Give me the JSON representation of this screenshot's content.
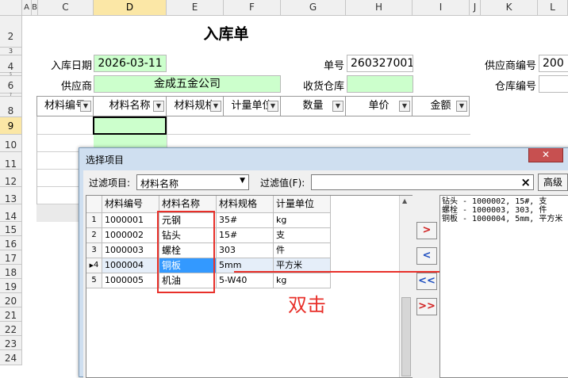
{
  "sheet": {
    "columns": [
      {
        "label": "A"
      },
      {
        "label": "B"
      },
      {
        "label": "C"
      },
      {
        "label": "D"
      },
      {
        "label": "E"
      },
      {
        "label": "F"
      },
      {
        "label": "G"
      },
      {
        "label": "H"
      },
      {
        "label": "I"
      },
      {
        "label": "J"
      },
      {
        "label": "K"
      },
      {
        "label": "L"
      }
    ],
    "rows": [
      "2",
      "3",
      "4",
      "5",
      "6",
      "7",
      "8",
      "9",
      "10",
      "11",
      "12",
      "13",
      "14",
      "15",
      "16",
      "17",
      "18",
      "19",
      "20",
      "21",
      "22",
      "23",
      "24"
    ],
    "title": "入库单",
    "form": {
      "date_label": "入库日期",
      "date_value": "2026-03-11",
      "order_label": "单号",
      "order_value": "260327001",
      "supplier_code_label": "供应商编号",
      "supplier_code_value": "200",
      "supplier_label": "供应商",
      "supplier_value": "金成五金公司",
      "warehouse_label": "收货仓库",
      "warehouse_value": "",
      "warehouse_code_label": "仓库编号",
      "warehouse_code_value": ""
    },
    "table_headers": [
      "材料编号",
      "材料名称",
      "材料规格",
      "计量单位",
      "数量",
      "单价",
      "金额"
    ]
  },
  "dialog": {
    "title": "选择项目",
    "close_label": "✕",
    "filter_item_label": "过滤项目:",
    "filter_item_value": "材料名称",
    "filter_value_label": "过滤值(F):",
    "filter_value": "",
    "clear_label": "×",
    "advanced_label": "高级",
    "columns": [
      "材料编号",
      "材料名称",
      "材料规格",
      "计量单位"
    ],
    "rows": [
      {
        "num": "1",
        "code": "1000001",
        "name": "元钢",
        "spec": "35#",
        "unit": "kg"
      },
      {
        "num": "2",
        "code": "1000002",
        "name": "钻头",
        "spec": "15#",
        "unit": "支"
      },
      {
        "num": "3",
        "code": "1000003",
        "name": "螺栓",
        "spec": "303",
        "unit": "件"
      },
      {
        "num": "4",
        "code": "1000004",
        "name": "铜板",
        "spec": "5mm",
        "unit": "平方米"
      },
      {
        "num": "5",
        "code": "1000005",
        "name": "机油",
        "spec": "5-W40",
        "unit": "kg"
      }
    ],
    "buttons": [
      ">",
      "<",
      "<<",
      ">>"
    ],
    "selected_items": [
      "钻头 - 1000002, 15#, 支",
      "螺栓 - 1000003, 303, 件",
      "铜板 - 1000004, 5mm, 平方米"
    ],
    "annotation": "双击",
    "colors": {
      "annotation_red": "#e8302a",
      "highlight_blue": "#3399ff",
      "cell_green": "#ccffcc"
    }
  }
}
